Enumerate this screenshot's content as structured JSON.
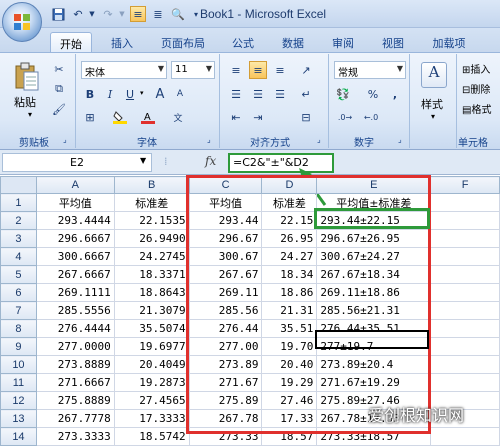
{
  "window": {
    "title": "Book1 - Microsoft Excel"
  },
  "ribbon_tabs": [
    "开始",
    "插入",
    "页面布局",
    "公式",
    "数据",
    "审阅",
    "视图",
    "加载项"
  ],
  "clipboard": {
    "paste_label": "粘贴",
    "group_label": "剪贴板"
  },
  "font": {
    "name": "宋体",
    "size": "11",
    "group_label": "字体",
    "bold": "B",
    "italic": "I",
    "underline": "U",
    "grow": "A",
    "shrink": "A"
  },
  "alignment": {
    "group_label": "对齐方式"
  },
  "number": {
    "format": "常规",
    "group_label": "数字",
    "percent": "%",
    "comma": ","
  },
  "styles": {
    "label": "样式"
  },
  "cells": {
    "insert": "插入",
    "delete": "删除",
    "format": "格式",
    "group_label": "单元格"
  },
  "formula_bar": {
    "name_box": "E2",
    "fx": "fx",
    "formula": "=C2&\"±\"&D2"
  },
  "grid": {
    "columns": [
      "A",
      "B",
      "C",
      "D",
      "E",
      "F"
    ],
    "rows": [
      [
        "1",
        "平均值",
        "标准差",
        "平均值",
        "标准差",
        "平均值±标准差",
        ""
      ],
      [
        "2",
        "293.4444",
        "22.1535",
        "293.44",
        "22.15",
        "293.44±22.15",
        ""
      ],
      [
        "3",
        "296.6667",
        "26.9490",
        "296.67",
        "26.95",
        "296.67±26.95",
        ""
      ],
      [
        "4",
        "300.6667",
        "24.2745",
        "300.67",
        "24.27",
        "300.67±24.27",
        ""
      ],
      [
        "5",
        "267.6667",
        "18.3371",
        "267.67",
        "18.34",
        "267.67±18.34",
        ""
      ],
      [
        "6",
        "269.1111",
        "18.8643",
        "269.11",
        "18.86",
        "269.11±18.86",
        ""
      ],
      [
        "7",
        "285.5556",
        "21.3079",
        "285.56",
        "21.31",
        "285.56±21.31",
        ""
      ],
      [
        "8",
        "276.4444",
        "35.5074",
        "276.44",
        "35.51",
        "276.44±35.51",
        ""
      ],
      [
        "9",
        "277.0000",
        "19.6977",
        "277.00",
        "19.70",
        "277±19.7",
        ""
      ],
      [
        "10",
        "273.8889",
        "20.4049",
        "273.89",
        "20.40",
        "273.89±20.4",
        ""
      ],
      [
        "11",
        "271.6667",
        "19.2873",
        "271.67",
        "19.29",
        "271.67±19.29",
        ""
      ],
      [
        "12",
        "275.8889",
        "27.4565",
        "275.89",
        "27.46",
        "275.89±27.46",
        ""
      ],
      [
        "13",
        "267.7778",
        "17.3333",
        "267.78",
        "17.33",
        "267.78±17.33",
        ""
      ],
      [
        "14",
        "273.3333",
        "18.5742",
        "273.33",
        "18.57",
        "273.33±18.57",
        ""
      ]
    ]
  },
  "watermark": "爱创根知识网",
  "colors": {
    "highlight_red": "#e0302d",
    "highlight_green": "#2e9a3a",
    "ribbon_blue": "#15428b"
  }
}
